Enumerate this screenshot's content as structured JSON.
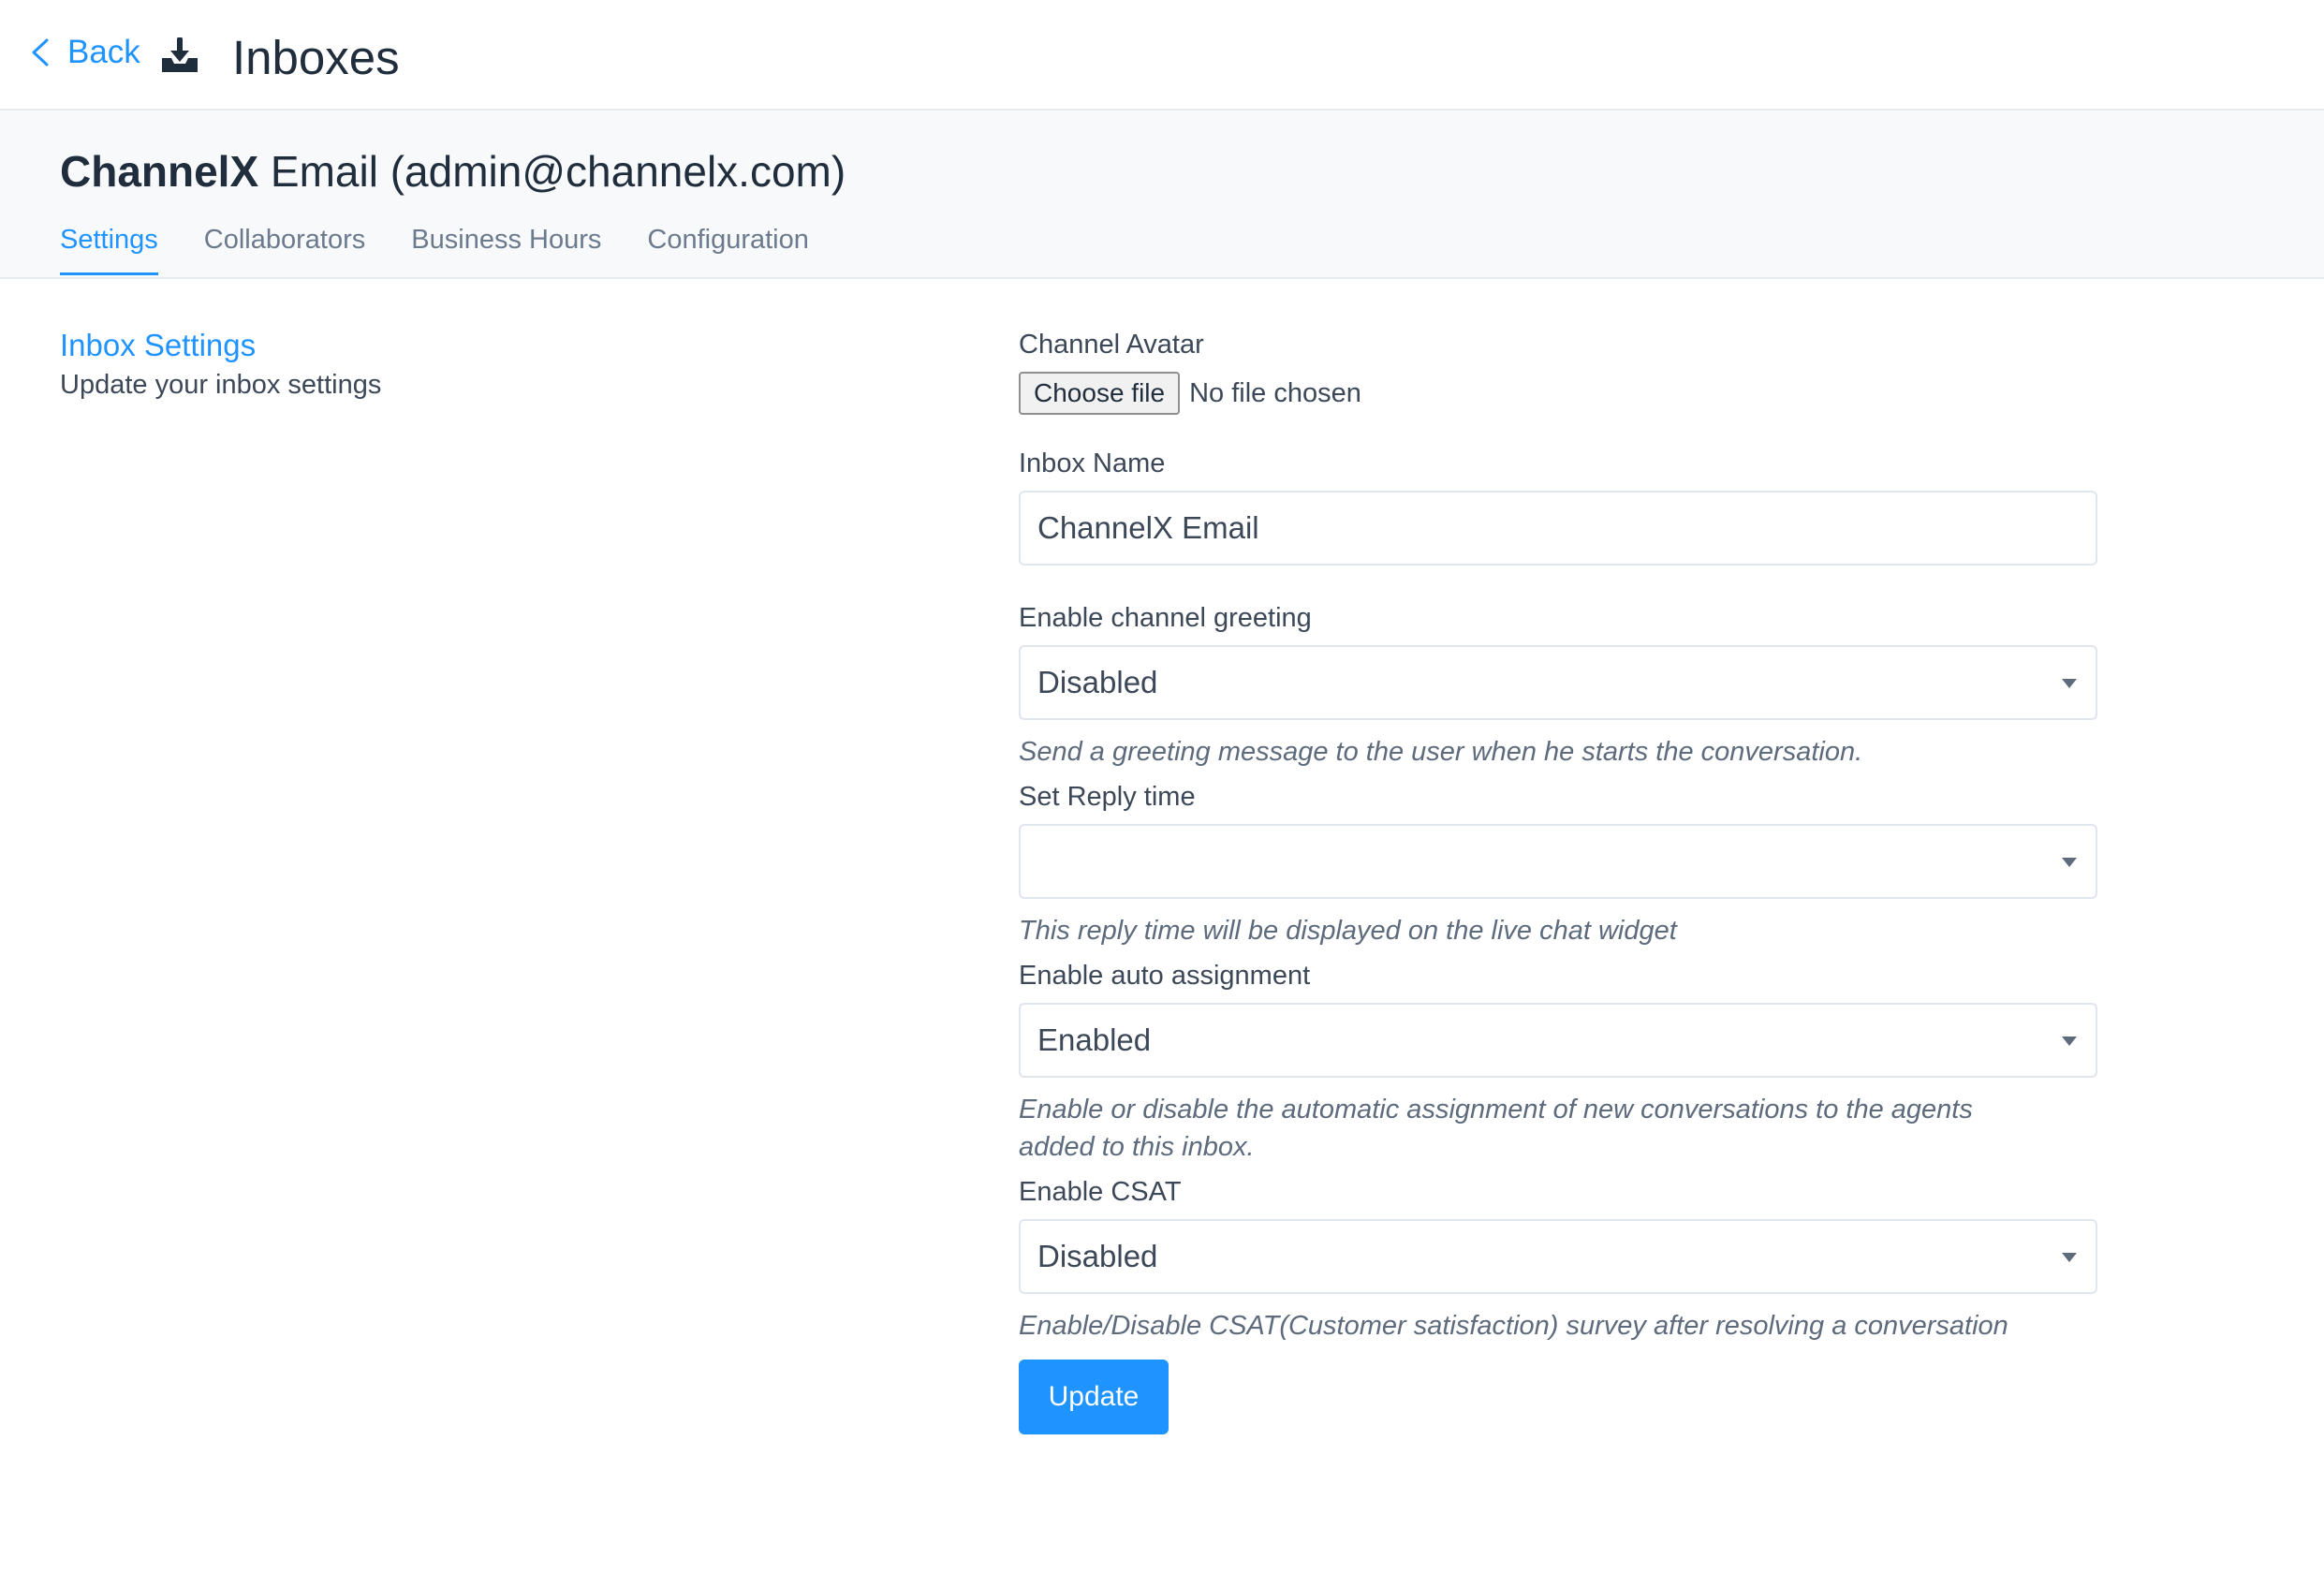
{
  "header": {
    "back_label": "Back",
    "title": "Inboxes"
  },
  "inbox": {
    "name_bold": "ChannelX",
    "name_rest": " Email (admin@channelx.com)",
    "tabs": [
      {
        "label": "Settings",
        "active": true
      },
      {
        "label": "Collaborators",
        "active": false
      },
      {
        "label": "Business Hours",
        "active": false
      },
      {
        "label": "Configuration",
        "active": false
      }
    ]
  },
  "sidebar": {
    "title": "Inbox Settings",
    "description": "Update your inbox settings"
  },
  "form": {
    "avatar": {
      "label": "Channel Avatar",
      "button_label": "Choose file",
      "status": "No file chosen"
    },
    "inbox_name": {
      "label": "Inbox Name",
      "value": "ChannelX Email"
    },
    "greeting": {
      "label": "Enable channel greeting",
      "value": "Disabled",
      "help": "Send a greeting message to the user when he starts the conversation."
    },
    "reply_time": {
      "label": "Set Reply time",
      "value": "",
      "help": "This reply time will be displayed on the live chat widget"
    },
    "auto_assignment": {
      "label": "Enable auto assignment",
      "value": "Enabled",
      "help_line1": "Enable or disable the automatic assignment of new conversations to the agents",
      "help_line2": "added to this inbox."
    },
    "csat": {
      "label": "Enable CSAT",
      "value": "Disabled",
      "help": "Enable/Disable CSAT(Customer satisfaction) survey after resolving a conversation"
    },
    "submit_label": "Update"
  },
  "colors": {
    "accent": "#1f93ff",
    "text": "#1f2d3d",
    "muted": "#6b7a8d",
    "border": "#e0e6ed"
  }
}
